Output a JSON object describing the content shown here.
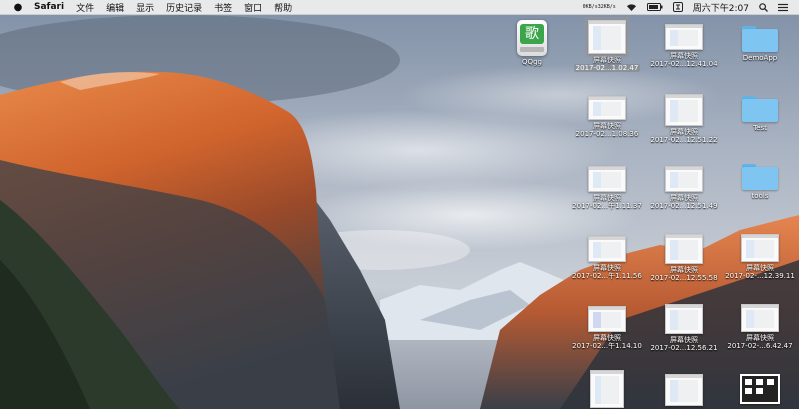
{
  "menubar": {
    "apple_icon": "apple-logo-icon",
    "app_name": "Safari",
    "menus": [
      "文件",
      "编辑",
      "显示",
      "历史记录",
      "书签",
      "窗口",
      "帮助"
    ],
    "status": {
      "network_top": "0KB/s",
      "network_bottom": "32KB/s",
      "clock": "周六下午2:07",
      "icons": [
        "network-monitor-icon",
        "wifi-icon",
        "battery-icon",
        "input-method-icon",
        "search-icon",
        "control-center-icon"
      ]
    }
  },
  "desktop": {
    "app": {
      "name": "QQgg",
      "glyph": "歌"
    },
    "folders": [
      {
        "name": "DemoApp"
      },
      {
        "name": "Test"
      },
      {
        "name": "tools"
      }
    ],
    "screenshots": [
      {
        "name": "屏幕快照",
        "date": "2017-02...1.02.47",
        "selected": true
      },
      {
        "name": "屏幕快照",
        "date": "2017-02...12.41.04",
        "selected": false
      },
      {
        "name": "屏幕快照",
        "date": "2017-02...1.08.36",
        "selected": false
      },
      {
        "name": "屏幕快照",
        "date": "2017-02...12.51.22",
        "selected": false
      },
      {
        "name": "屏幕快照",
        "date": "2017-02...午1.11.37",
        "selected": false
      },
      {
        "name": "屏幕快照",
        "date": "2017-02...12.51.49",
        "selected": false
      },
      {
        "name": "屏幕快照",
        "date": "2017-02...午1.11.56",
        "selected": false
      },
      {
        "name": "屏幕快照",
        "date": "2017-02...12.55.58",
        "selected": false
      },
      {
        "name": "屏幕快照",
        "date": "2017-02-...12.39.11",
        "selected": false
      },
      {
        "name": "屏幕快照",
        "date": "2017-02...午1.14.10",
        "selected": false
      },
      {
        "name": "屏幕快照",
        "date": "2017-02...12.56.21",
        "selected": false
      },
      {
        "name": "屏幕快照",
        "date": "2017-02-...6.42.47",
        "selected": false
      }
    ]
  }
}
